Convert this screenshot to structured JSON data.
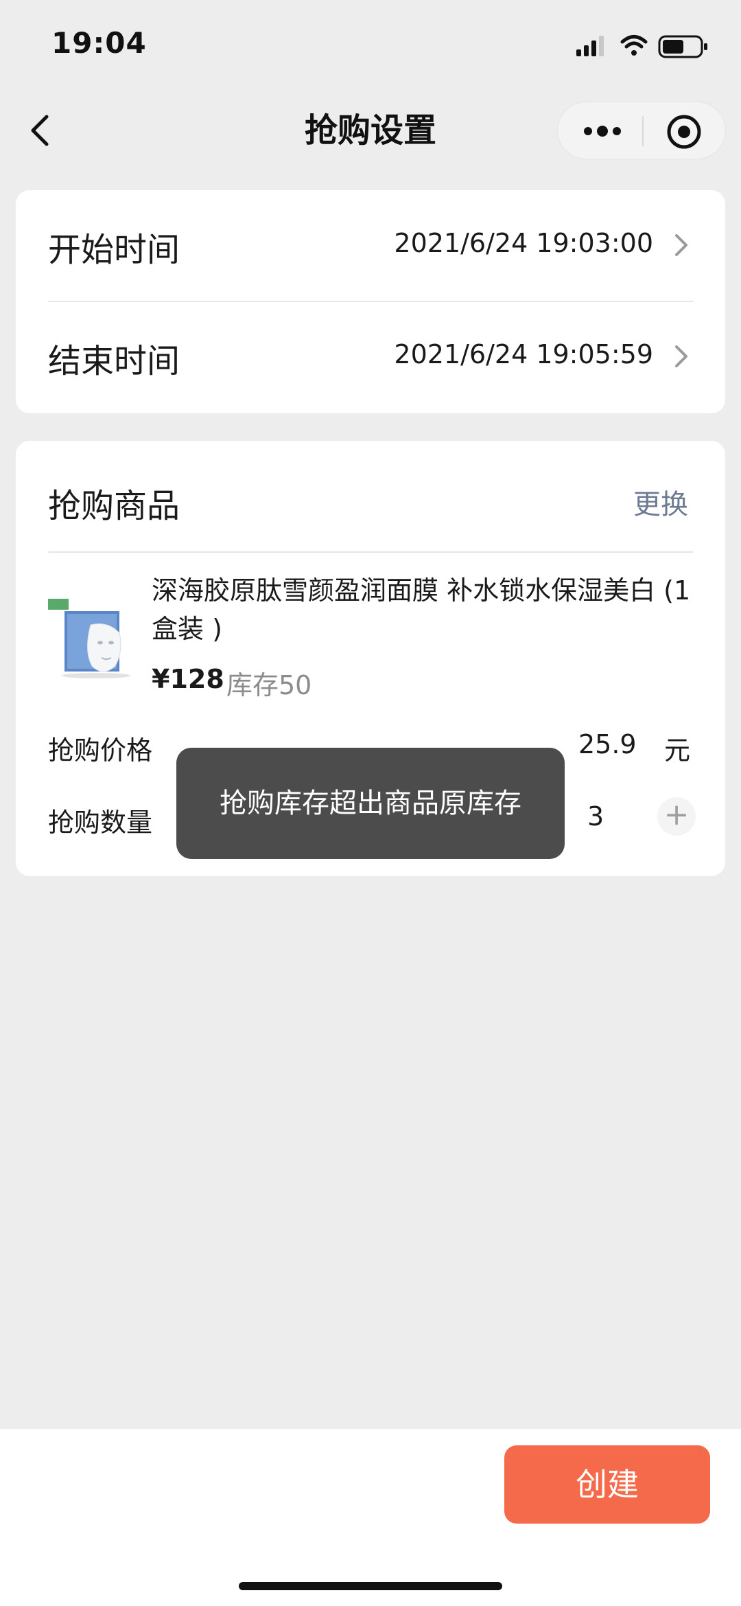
{
  "status_bar": {
    "time": "19:04"
  },
  "nav": {
    "title": "抢购设置"
  },
  "time_card": {
    "start_label": "开始时间",
    "start_value": "2021/6/24 19:03:00",
    "end_label": "结束时间",
    "end_value": "2021/6/24 19:05:59"
  },
  "goods_card": {
    "title": "抢购商品",
    "change_label": "更换",
    "product": {
      "name": "深海胶原肽雪颜盈润面膜 补水锁水保湿美白 (1盒装 )",
      "price": "¥128",
      "stock": "库存50"
    },
    "flash_price_label": "抢购价格",
    "flash_price_value": "25.9",
    "flash_price_unit": "元",
    "flash_qty_label": "抢购数量",
    "flash_qty_value": "3"
  },
  "toast": {
    "message": "抢购库存超出商品原库存"
  },
  "bottom": {
    "create_label": "创建"
  },
  "colors": {
    "background": "#ededed",
    "card": "#ffffff",
    "accent_button": "#f56a4a",
    "link": "#6c7a93",
    "toast_bg": "#4c4c4c"
  }
}
